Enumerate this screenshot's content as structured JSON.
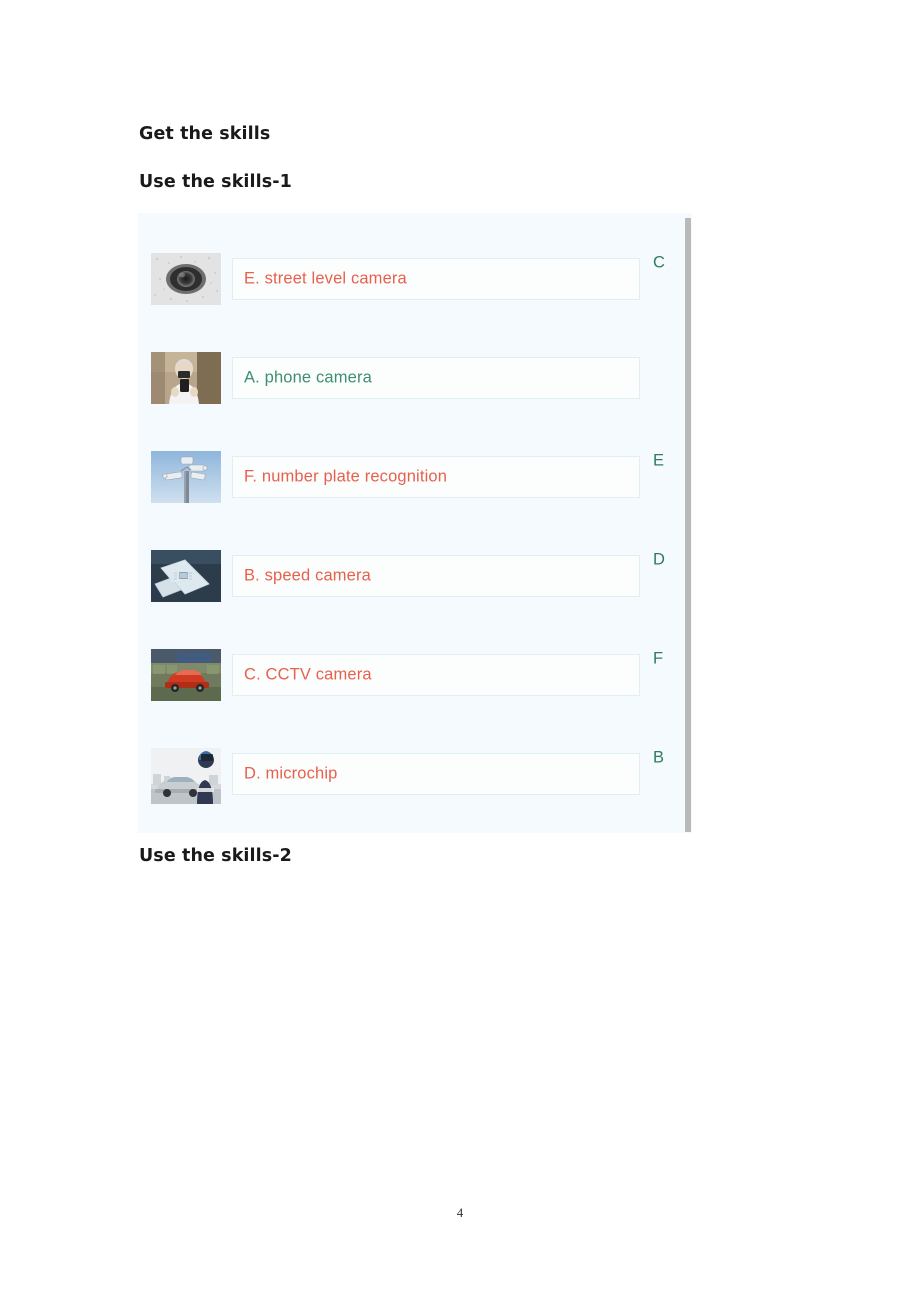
{
  "document": {
    "headings": {
      "get_the_skills": "Get the skills",
      "use_the_skills_1": "Use the skills-1",
      "use_the_skills_2": "Use the skills-2"
    },
    "page_number": "4"
  },
  "colors": {
    "panel_background": "#f4fafd",
    "answer_box_background": "#fcfefe",
    "answer_box_border": "#e0efef",
    "incorrect_text": "#e8604c",
    "correct_text": "#3f8f6f",
    "marker_text": "#2f7d5c",
    "scrollbar_thumb": "#b9b9b9",
    "heading_text": "#1a1a1a"
  },
  "activity": {
    "scrollbar": {
      "name": "vertical-scrollbar",
      "position": "right"
    },
    "rows": [
      {
        "thumbnail_name": "dome-cctv-camera-photo",
        "answer_text": "E.  street level camera",
        "state": "incorrect",
        "marker": "C"
      },
      {
        "thumbnail_name": "person-holding-phone-photo",
        "answer_text": "A.  phone camera",
        "state": "correct",
        "marker": ""
      },
      {
        "thumbnail_name": "cameras-on-pole-photo",
        "answer_text": "F.  number plate recognition",
        "state": "incorrect",
        "marker": "E"
      },
      {
        "thumbnail_name": "microchip-photo",
        "answer_text": "B.  speed camera",
        "state": "incorrect",
        "marker": "D"
      },
      {
        "thumbnail_name": "red-car-traffic-photo",
        "answer_text": "C.  CCTV camera",
        "state": "incorrect",
        "marker": "F"
      },
      {
        "thumbnail_name": "speed-camera-operator-photo",
        "answer_text": "D.  microchip",
        "state": "incorrect",
        "marker": "B"
      }
    ]
  }
}
